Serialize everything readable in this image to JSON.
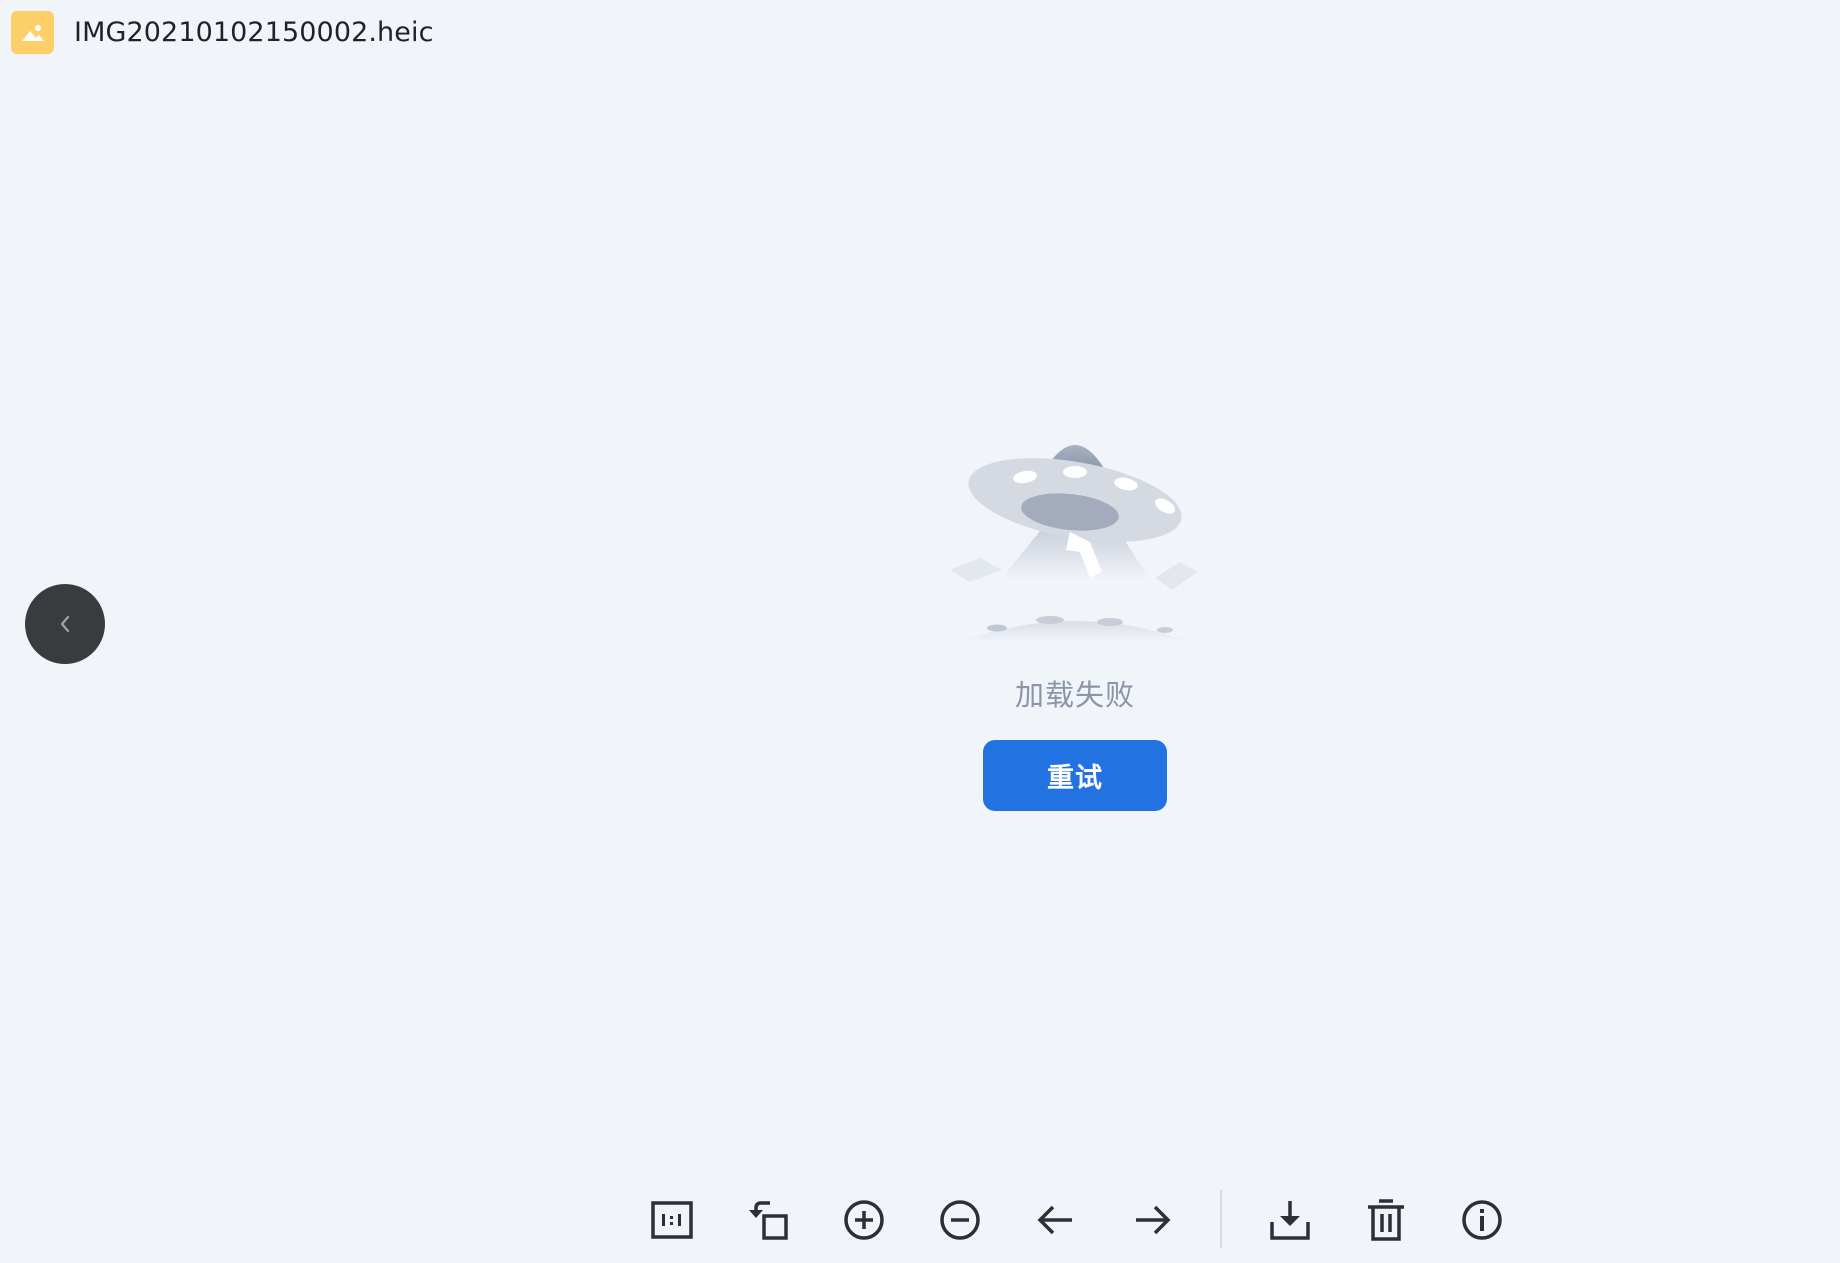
{
  "header": {
    "file_name": "IMG20210102150002.heic",
    "file_icon": "image-file-icon",
    "file_icon_color": "#fccf6b"
  },
  "nav": {
    "prev_icon": "chevron-left-icon"
  },
  "error": {
    "message": "加载失败",
    "retry_label": "重试",
    "illustration": "ufo-illustration"
  },
  "toolbar": {
    "items": [
      {
        "name": "actual-size",
        "icon": "one-to-one-icon"
      },
      {
        "name": "rotate",
        "icon": "rotate-left-icon"
      },
      {
        "name": "zoom-in",
        "icon": "zoom-in-icon"
      },
      {
        "name": "zoom-out",
        "icon": "zoom-out-icon"
      },
      {
        "name": "previous",
        "icon": "arrow-left-icon"
      },
      {
        "name": "next",
        "icon": "arrow-right-icon"
      },
      {
        "name": "download",
        "icon": "download-icon"
      },
      {
        "name": "delete",
        "icon": "trash-icon"
      },
      {
        "name": "info",
        "icon": "info-icon"
      }
    ]
  },
  "colors": {
    "background": "#f1f5fa",
    "primary": "#2273e1",
    "error_text": "#8a96a8",
    "nav_button": "#3a3b3f"
  }
}
